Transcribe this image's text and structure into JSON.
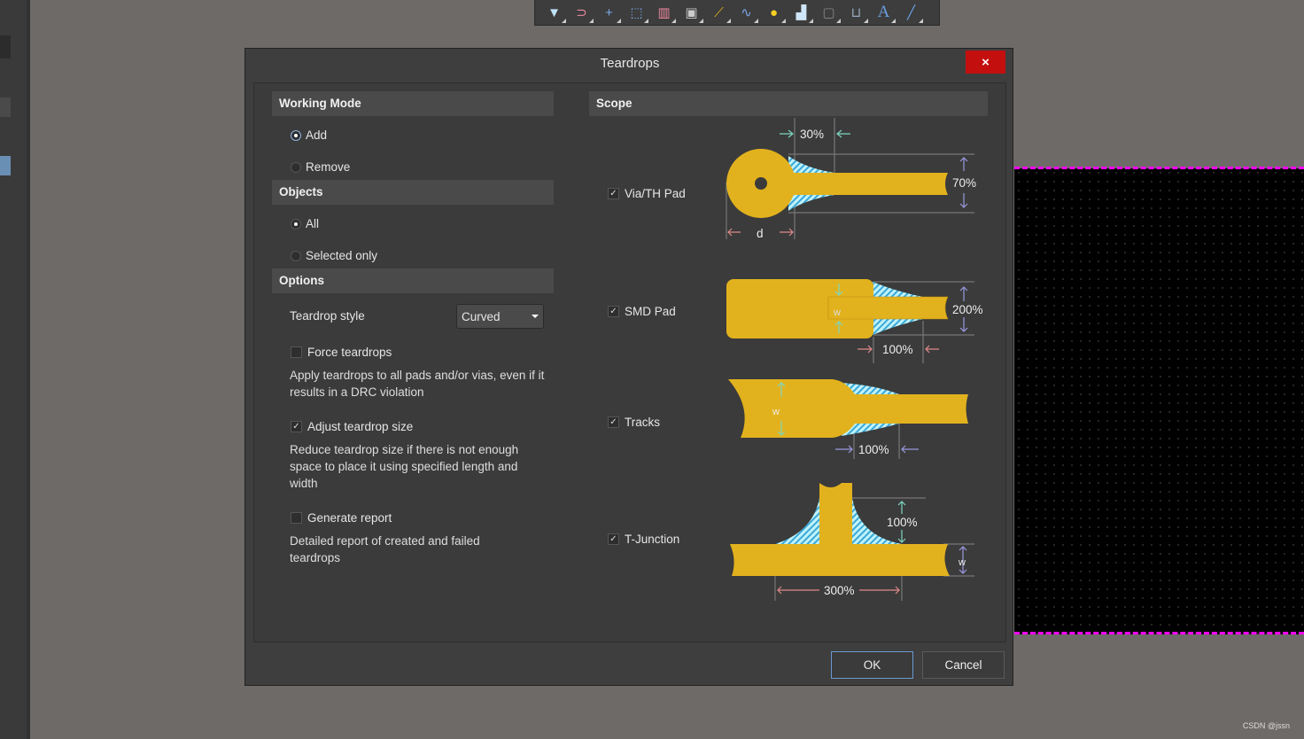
{
  "toolbar": {
    "icons": [
      "filter-icon",
      "interactive-routing-icon",
      "crosshair-icon",
      "selection-box-icon",
      "bar-chart-icon",
      "component-icon",
      "route-icon",
      "length-tuning-icon",
      "via-icon",
      "polygon-icon",
      "keepout-icon",
      "dimension-icon",
      "text-icon",
      "line-icon"
    ]
  },
  "dialog": {
    "title": "Teardrops",
    "close_label": "×",
    "working_mode": {
      "header": "Working Mode",
      "options": [
        "Add",
        "Remove"
      ],
      "selected": "Add"
    },
    "objects": {
      "header": "Objects",
      "options": [
        "All",
        "Selected only"
      ],
      "selected": "All"
    },
    "options": {
      "header": "Options",
      "teardrop_style_label": "Teardrop style",
      "teardrop_style_value": "Curved",
      "force": {
        "label": "Force teardrops",
        "checked": false,
        "desc": "Apply teardrops to all pads and/or vias, even if it results in a DRC violation"
      },
      "adjust": {
        "label": "Adjust teardrop size",
        "checked": true,
        "desc": "Reduce teardrop size if there is not enough space to place it using specified length and width"
      },
      "report": {
        "label": "Generate report",
        "checked": false,
        "desc": "Detailed report of created and failed teardrops"
      }
    },
    "scope": {
      "header": "Scope",
      "items": [
        {
          "label": "Via/TH Pad",
          "checked": true,
          "length": "30%",
          "width": "70%",
          "dim": "d"
        },
        {
          "label": "SMD Pad",
          "checked": true,
          "length": "100%",
          "width": "200%",
          "dim": "w"
        },
        {
          "label": "Tracks",
          "checked": true,
          "length": "100%",
          "dim": "w"
        },
        {
          "label": "T-Junction",
          "checked": true,
          "length": "300%",
          "width": "100%",
          "dim": "w"
        }
      ]
    },
    "ok_label": "OK",
    "cancel_label": "Cancel"
  },
  "colors": {
    "copper": "#e2b21e",
    "hatch": "#7fe0f0",
    "close": "#c40f0f",
    "canvas_border": "#ff00ff"
  },
  "watermark": "CSDN @jssn"
}
